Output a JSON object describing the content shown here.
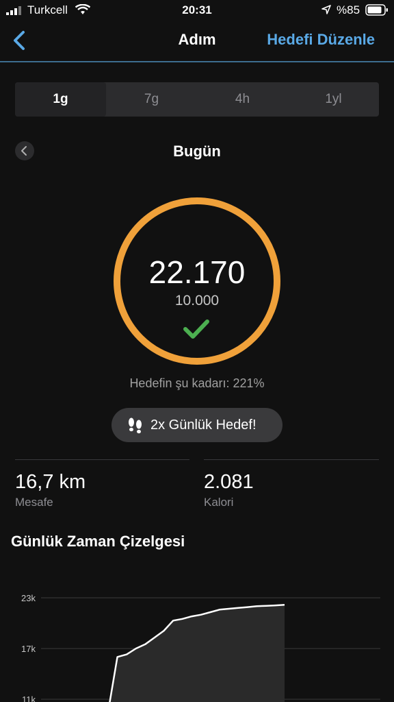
{
  "status_bar": {
    "carrier": "Turkcell",
    "time": "20:31",
    "battery": "%85"
  },
  "nav": {
    "title": "Adım",
    "edit_label": "Hedefi Düzenle"
  },
  "tabs": [
    {
      "label": "1g",
      "active": true
    },
    {
      "label": "7g",
      "active": false
    },
    {
      "label": "4h",
      "active": false
    },
    {
      "label": "1yl",
      "active": false
    }
  ],
  "date_title": "Bugün",
  "summary": {
    "steps": "22.170",
    "goal": "10.000",
    "goal_percent_text": "Hedefin şu kadarı: 221%",
    "ring_color": "#f0a13a",
    "check_color": "#4caf50"
  },
  "badge": {
    "label": "2x Günlük Hedef!",
    "icon": "footsteps-icon"
  },
  "stats": [
    {
      "value": "16,7 km",
      "label": "Mesafe"
    },
    {
      "value": "2.081",
      "label": "Kalori"
    }
  ],
  "timeline": {
    "title": "Günlük Zaman Çizelgesi"
  },
  "chart_data": {
    "type": "area",
    "y_ticks": [
      "23k",
      "17k",
      "11k"
    ],
    "ylim": [
      11000,
      23000
    ],
    "x": [
      0,
      1,
      2,
      3,
      4,
      5,
      6,
      7,
      8,
      9,
      10,
      11,
      12,
      13,
      14,
      15,
      16,
      17,
      18,
      19
    ],
    "values": [
      9500,
      16000,
      16300,
      17000,
      17500,
      18300,
      19100,
      20300,
      20500,
      20800,
      21000,
      21300,
      21600,
      21700,
      21800,
      21900,
      22000,
      22050,
      22100,
      22170
    ],
    "grid": true
  }
}
